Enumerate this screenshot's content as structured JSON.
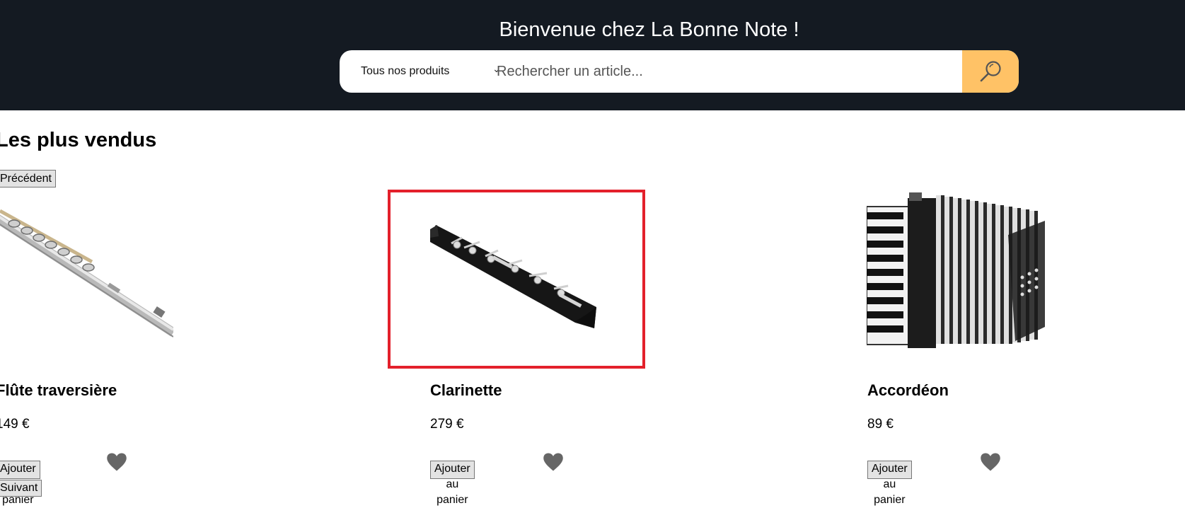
{
  "header": {
    "welcome": "Bienvenue chez La Bonne Note !",
    "search": {
      "category_value": "Tous nos produits",
      "placeholder": "Rechercher un article...",
      "button_icon": "search-icon"
    },
    "colors": {
      "background": "#141a22",
      "search_button": "#ffc266"
    }
  },
  "bestsellers": {
    "title": "Les plus vendus",
    "prev_label": "Précédent",
    "next_label": "Suivant",
    "products": [
      {
        "name": "Flûte traversière",
        "price": "149 €",
        "add_label": "Ajouter au panier",
        "image": "flute-image",
        "favorite_icon": "heart-icon"
      },
      {
        "name": "Clarinette",
        "price": "279 €",
        "add_label": "Ajouter au panier",
        "image": "clarinet-image",
        "favorite_icon": "heart-icon"
      },
      {
        "name": "Accordéon",
        "price": "89 €",
        "add_label": "Ajouter au panier",
        "image": "accordion-image",
        "favorite_icon": "heart-icon"
      }
    ]
  },
  "highlight_color": "#e3202b"
}
